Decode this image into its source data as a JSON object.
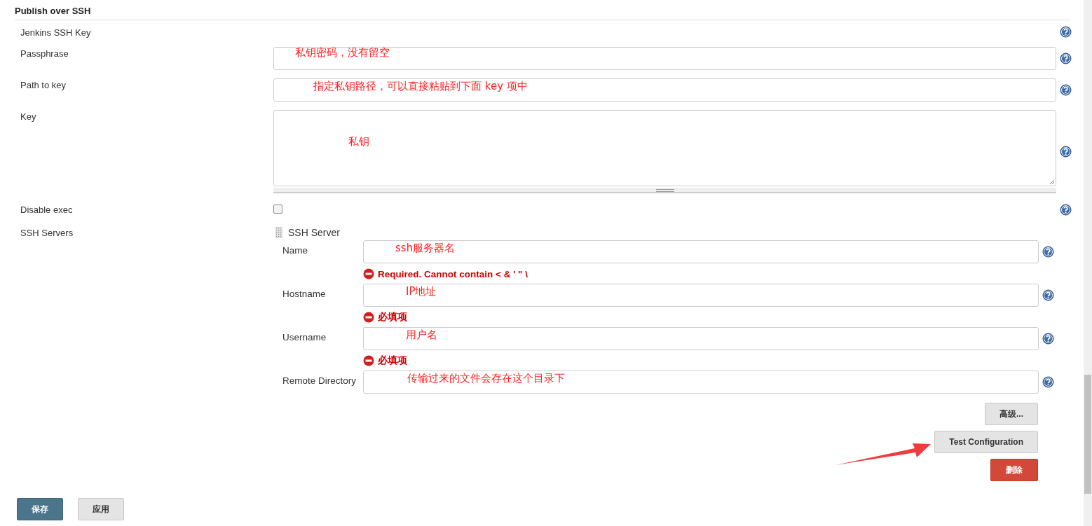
{
  "section_title": "Publish over SSH",
  "rows": [
    {
      "label": "Jenkins SSH Key",
      "kind": "none"
    },
    {
      "label": "Passphrase",
      "kind": "input",
      "annotation": "私钥密码，没有留空"
    },
    {
      "label": "Path to key",
      "kind": "input",
      "annotation": "指定私钥路径，可以直接粘贴到下面 key 项中"
    },
    {
      "label": "Key",
      "kind": "textarea",
      "annotation": "私钥"
    },
    {
      "label": "Disable exec",
      "kind": "checkbox",
      "checked": false
    }
  ],
  "ssh_servers": {
    "label": "SSH Servers",
    "server_title": "SSH Server",
    "fields": [
      {
        "label": "Name",
        "annotation": "ssh服务器名",
        "error": "Required. Cannot contain < & ' \" \\"
      },
      {
        "label": "Hostname",
        "annotation": "IP地址",
        "error": "必填项"
      },
      {
        "label": "Username",
        "annotation": "用户名",
        "error": "必填项"
      },
      {
        "label": "Remote Directory",
        "annotation": "传输过来的文件会存在这个目录下"
      }
    ],
    "buttons": [
      {
        "label": "高级...",
        "kind": "default"
      },
      {
        "label": "Test Configuration",
        "kind": "default"
      },
      {
        "label": "删除",
        "kind": "danger"
      }
    ]
  },
  "footer_buttons": [
    {
      "label": "保存",
      "kind": "primary"
    },
    {
      "label": "应用",
      "kind": "default"
    }
  ]
}
